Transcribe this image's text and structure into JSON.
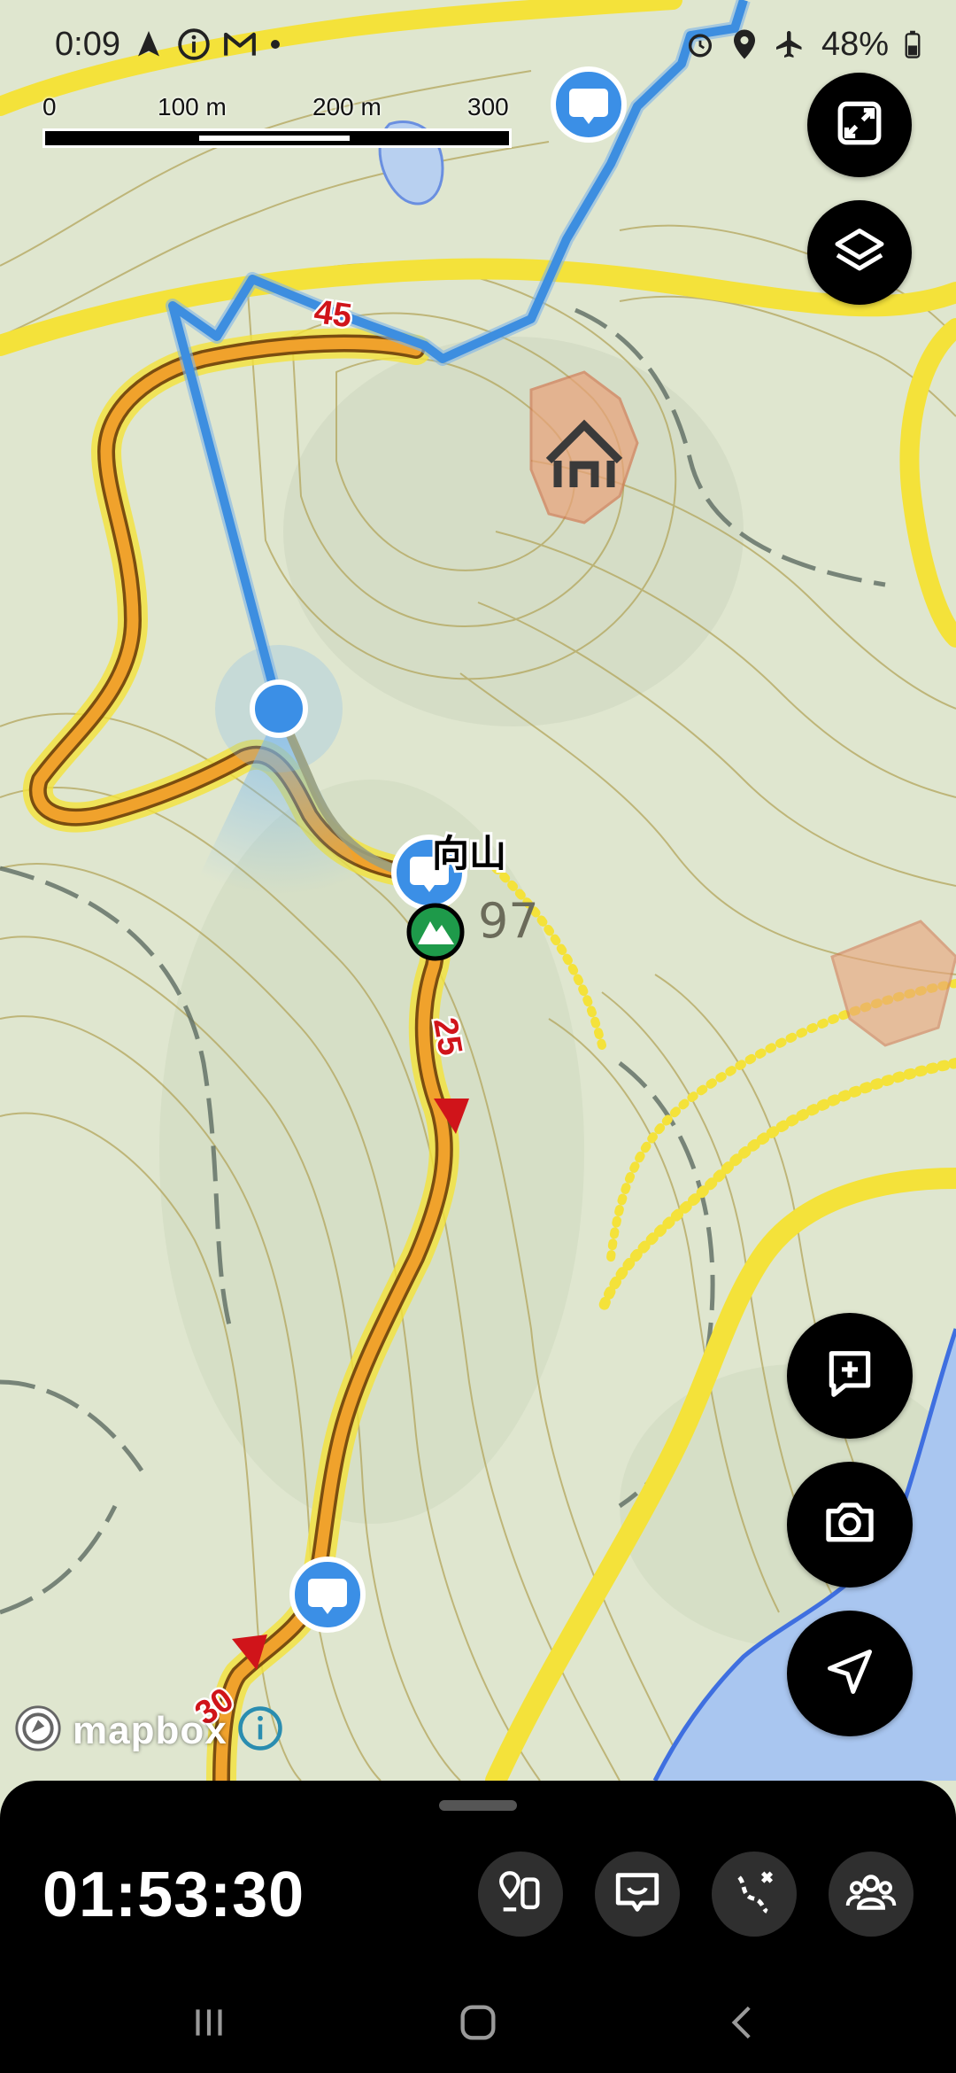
{
  "status_bar": {
    "time": "0:09",
    "battery": "48%",
    "left_icons": [
      "navigation-arrow-icon",
      "info-icon",
      "gmail-icon",
      "dot-icon"
    ],
    "right_icons": [
      "alarm-icon",
      "location-icon",
      "airplane-mode-icon",
      "battery-icon"
    ]
  },
  "scale_bar": {
    "labels": [
      "0",
      "100 m",
      "200 m",
      "300 m"
    ]
  },
  "map": {
    "peak_name": "向山",
    "elevation_label": "97",
    "distance_markers": [
      "45",
      "25",
      "30"
    ],
    "attribution": "mapbox",
    "colors": {
      "terrain": "#dfe6cf",
      "contour": "#b0a05a",
      "trail": "#f0a22c",
      "road_highlight": "#f4e23a",
      "recorded_track": "#3d8ee0",
      "water": "#a9c6f0",
      "marker": "#3b8fe6",
      "distance_label": "#d0141a"
    }
  },
  "controls": {
    "top_right": [
      "fullscreen-icon",
      "layers-icon"
    ],
    "bottom_right": [
      "add-note-icon",
      "camera-icon",
      "navigate-icon"
    ]
  },
  "bottom_panel": {
    "timer": "01:53:30",
    "tools": [
      "waypoint-gallery-icon",
      "chat-message-icon",
      "route-icon",
      "group-icon"
    ]
  },
  "nav_bar": [
    "recent-apps-icon",
    "home-icon",
    "back-icon"
  ]
}
